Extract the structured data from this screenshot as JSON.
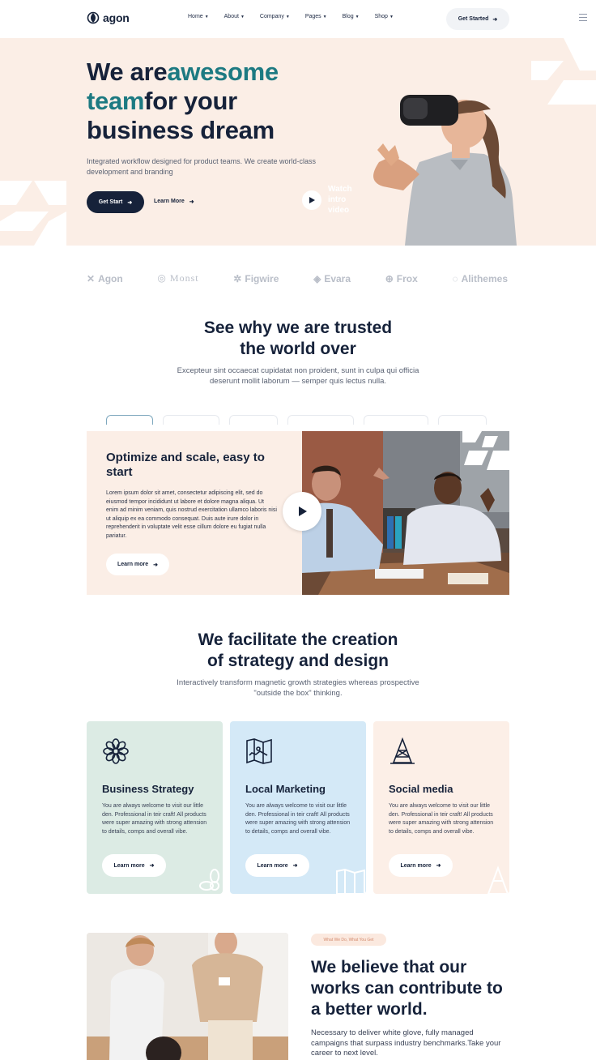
{
  "nav": {
    "logo": "agon",
    "menu": [
      {
        "label": "Home"
      },
      {
        "label": "About"
      },
      {
        "label": "Company"
      },
      {
        "label": "Pages"
      },
      {
        "label": "Blog"
      },
      {
        "label": "Shop"
      }
    ],
    "cta": "Get Started"
  },
  "hero": {
    "title_part1": "We are",
    "title_accent1": "awesome",
    "title_accent2": "team",
    "title_part2": "for your business dream",
    "subtitle": "Integrated workflow designed for product teams. We create world-class development and branding",
    "primary_button": "Get Start",
    "secondary_button": "Learn More",
    "watch_label": "Watch intro video"
  },
  "brands": [
    "Agon",
    "Monst",
    "Figwire",
    "Evara",
    "Frox",
    "Alithemes"
  ],
  "trusted": {
    "title_line1": "See why we are trusted",
    "title_line2": "the world over",
    "subtitle_line1": "Excepteur sint occaecat cupidatat non proident, sunt in culpa qui officia",
    "subtitle_line2": "deserunt mollit laborum — semper quis lectus nulla."
  },
  "optimize": {
    "title": "Optimize and scale, easy to start",
    "body": "Lorem ipsum dolor sit amet, consectetur adipiscing elit, sed do eiusmod tempor incididunt ut labore et dolore magna aliqua. Ut enim ad minim veniam, quis nostrud exercitation ullamco laboris nisi ut aliquip ex ea commodo consequat. Duis aute irure dolor in reprehenderit in voluptate velit esse cillum dolore eu fugiat nulla pariatur.",
    "button": "Learn more"
  },
  "facilitate": {
    "title_line1": "We facilitate the creation",
    "title_line2": "of strategy and design",
    "subtitle_line1": "Interactively transform magnetic growth strategies whereas prospective",
    "subtitle_line2": "\"outside the box\" thinking."
  },
  "cards": [
    {
      "title": "Business Strategy",
      "body": "You are always welcome to visit our little den. Professional in teir craft! All products were super amazing with strong attension to details, comps and overall vibe.",
      "button": "Learn more",
      "color": "#dcebe4"
    },
    {
      "title": "Local Marketing",
      "body": "You are always welcome to visit our little den. Professional in teir craft! All products were super amazing with strong attension to details, comps and overall vibe.",
      "button": "Learn more",
      "color": "#d4e9f7"
    },
    {
      "title": "Social media",
      "body": "You are always welcome to visit our little den. Professional in teir craft! All products were super amazing with strong attension to details, comps and overall vibe.",
      "button": "Learn more",
      "color": "#fcefe7"
    }
  ],
  "believe": {
    "badge": "What We Do, What You Get",
    "title": "We believe that our works can contribute to a better world.",
    "body": "Necessary to deliver white glove, fully managed campaigns that surpass industry benchmarks.Take your career to next level."
  },
  "colors": {
    "navy": "#16223a",
    "teal": "#1d7a82",
    "peach": "#fbeee6"
  }
}
